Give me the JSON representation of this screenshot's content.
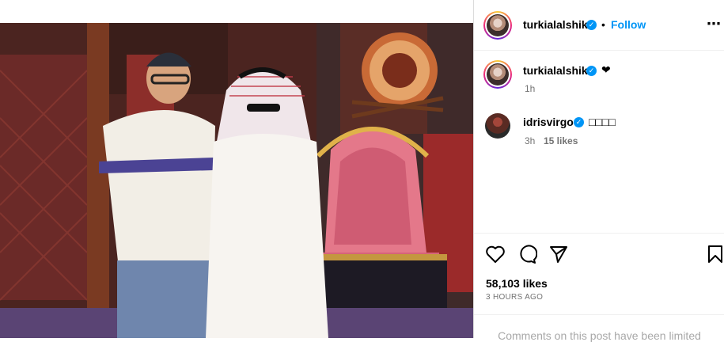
{
  "post": {
    "author": "turkialalshik",
    "follow_label": "Follow",
    "dot": "•",
    "more_label": "•••",
    "caption_heart": "❤",
    "caption_time": "1h",
    "likes": "58,103 likes",
    "posted_ago": "3 HOURS AGO",
    "limited_notice": "Comments on this post have been limited"
  },
  "comments": [
    {
      "username": "idrisvirgo",
      "text": "□□□□",
      "time": "3h",
      "likes": "15 likes"
    }
  ],
  "icons": {
    "verified": "verified-badge",
    "like": "heart-icon",
    "comment": "comment-icon",
    "share": "share-icon",
    "save": "bookmark-icon"
  },
  "colors": {
    "accent": "#0095f6",
    "muted": "#737373",
    "divider": "#efefef"
  }
}
